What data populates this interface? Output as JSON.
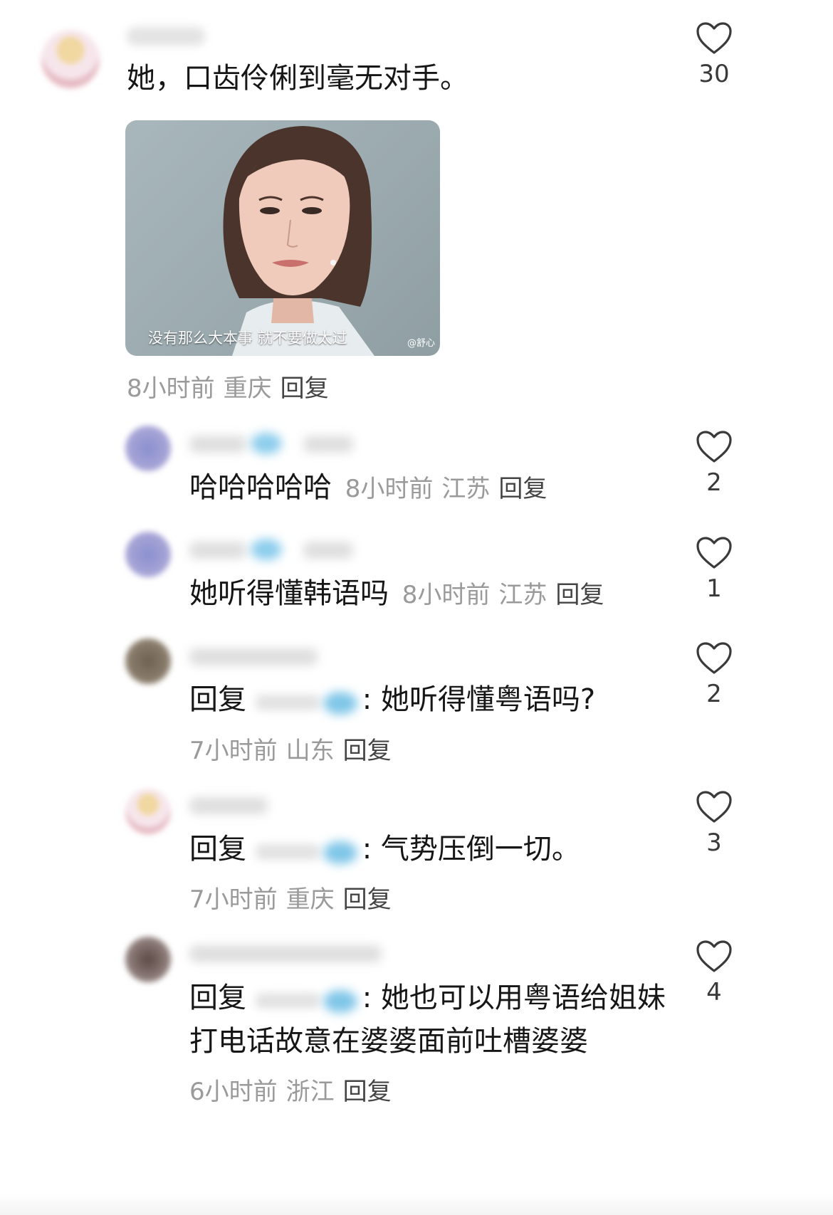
{
  "main_comment": {
    "text": "她，口齿伶俐到毫无对手。",
    "image_caption": "没有那么大本事 就不要做太过",
    "image_watermark": "@舒心",
    "time": "8小时前",
    "location": "重庆",
    "reply_label": "回复",
    "likes": "30"
  },
  "replies": [
    {
      "text": "哈哈哈哈哈",
      "time": "8小时前",
      "location": "江苏",
      "reply_label": "回复",
      "likes": "2"
    },
    {
      "text": "她听得懂韩语吗",
      "time": "8小时前",
      "location": "江苏",
      "reply_label": "回复",
      "likes": "1"
    },
    {
      "prefix": "回复",
      "text": ": 她听得懂粤语吗?",
      "time": "7小时前",
      "location": "山东",
      "reply_label": "回复",
      "likes": "2"
    },
    {
      "prefix": "回复",
      "text": ": 气势压倒一切。",
      "time": "7小时前",
      "location": "重庆",
      "reply_label": "回复",
      "likes": "3"
    },
    {
      "prefix": "回复",
      "text": ": 她也可以用粤语给姐妹",
      "text_line2": "打电话故意在婆婆面前吐槽婆婆",
      "time": "6小时前",
      "location": "浙江",
      "reply_label": "回复",
      "likes": "4"
    }
  ],
  "icons": {
    "like": "heart-outline-icon"
  },
  "colors": {
    "meta": "#9a9a9a",
    "text": "#161616",
    "heart": "#3a3a3a"
  }
}
